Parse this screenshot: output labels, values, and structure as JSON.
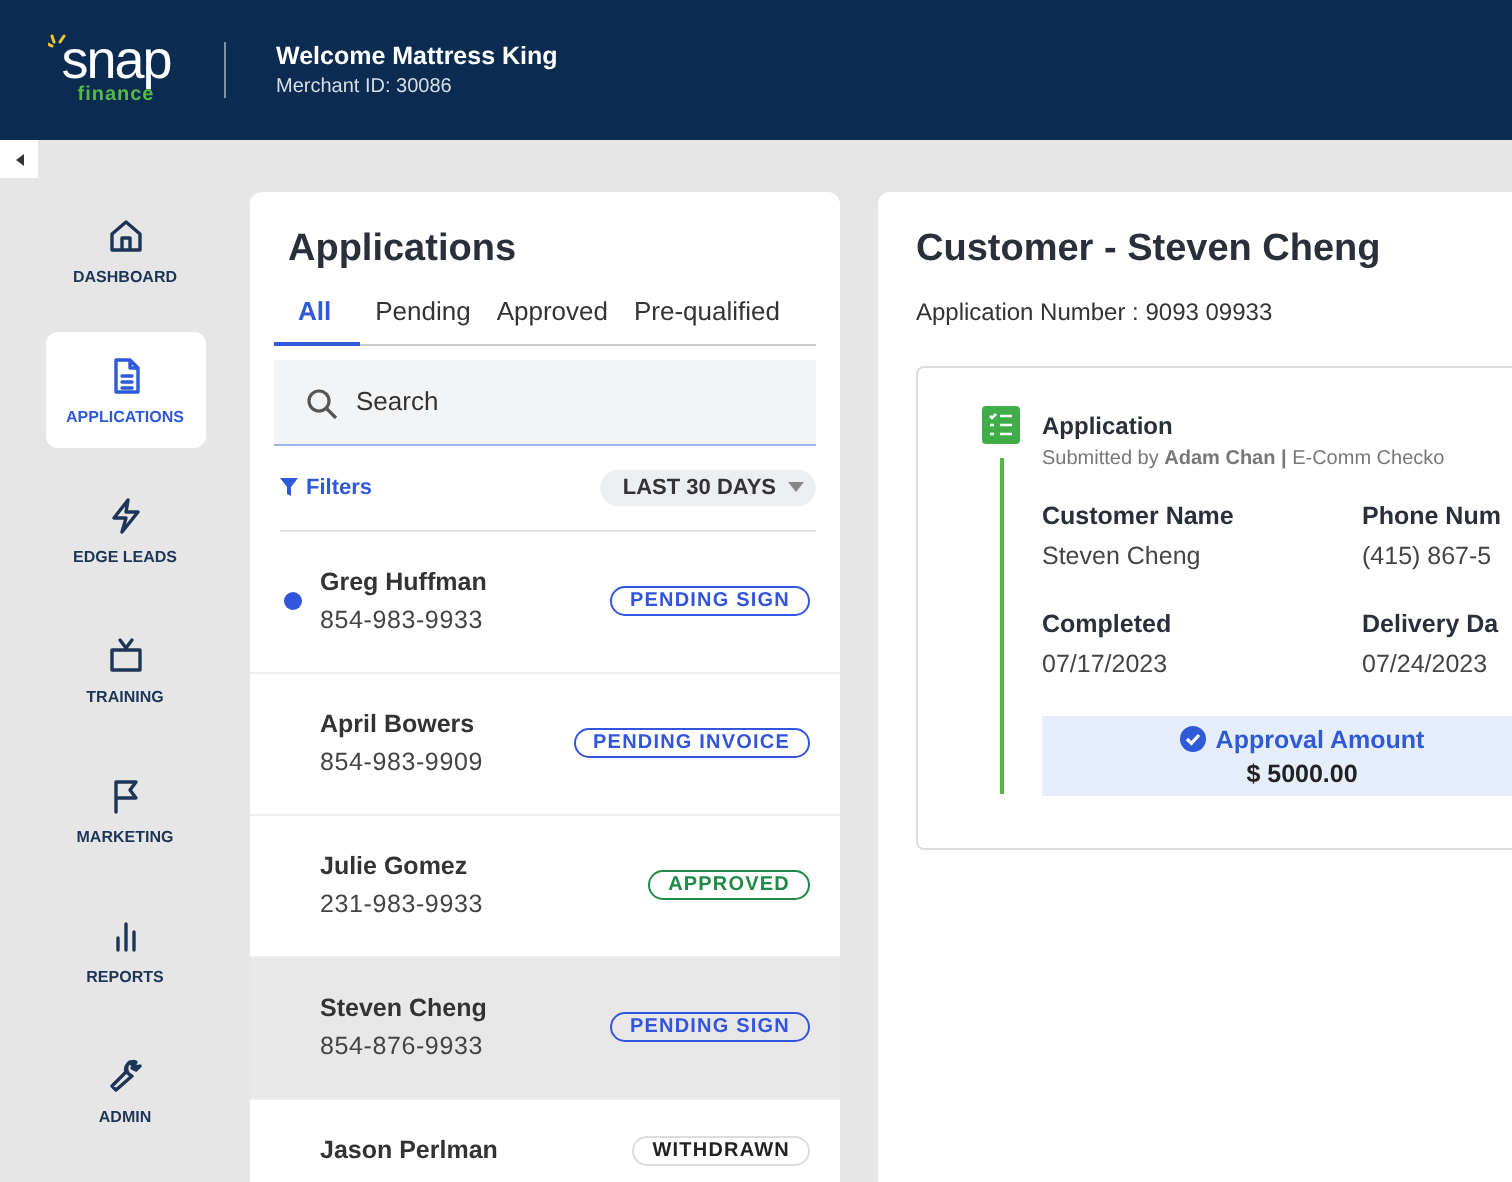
{
  "header": {
    "logo": {
      "word": "snap",
      "sub": "finance"
    },
    "welcome": "Welcome Mattress King",
    "merchant_id": "Merchant ID: 30086"
  },
  "sidebar": {
    "items": [
      {
        "kind": "home",
        "label": "DASHBOARD",
        "selected": false
      },
      {
        "kind": "document",
        "label": "APPLICATIONS",
        "selected": true
      },
      {
        "kind": "bolt",
        "label": "EDGE LEADS",
        "selected": false
      },
      {
        "kind": "tv",
        "label": "TRAINING",
        "selected": false
      },
      {
        "kind": "flag",
        "label": "MARKETING",
        "selected": false
      },
      {
        "kind": "bars",
        "label": "REPORTS",
        "selected": false
      },
      {
        "kind": "wrench",
        "label": "ADMIN",
        "selected": false
      }
    ]
  },
  "applications": {
    "title": "Applications",
    "tabs": [
      {
        "label": "All",
        "selected": true
      },
      {
        "label": "Pending",
        "selected": false
      },
      {
        "label": "Approved",
        "selected": false
      },
      {
        "label": "Pre-qualified",
        "selected": false
      }
    ],
    "search": {
      "placeholder": "Search"
    },
    "filters": "Filters",
    "date_range": "LAST 30 DAYS",
    "rows": [
      {
        "name": "Greg Huffman",
        "phone": "854-983-9933",
        "status": "PENDING SIGN",
        "kind": "pending",
        "unread": true,
        "selected": false
      },
      {
        "name": "April Bowers",
        "phone": "854-983-9909",
        "status": "PENDING INVOICE",
        "kind": "pending",
        "unread": false,
        "selected": false
      },
      {
        "name": "Julie Gomez",
        "phone": "231-983-9933",
        "status": "APPROVED",
        "kind": "approved",
        "unread": false,
        "selected": false
      },
      {
        "name": "Steven Cheng",
        "phone": "854-876-9933",
        "status": "PENDING SIGN",
        "kind": "pending",
        "unread": false,
        "selected": true
      },
      {
        "name": "Jason Perlman",
        "status": "WITHDRAWN",
        "kind": "withdrawn",
        "unread": false,
        "selected": false
      }
    ]
  },
  "detail": {
    "title": "Customer - Steven Cheng",
    "application_number": "Application Number : 9093 09933",
    "card": {
      "title": "Application",
      "submitted": "Submitted by **Adam Chan |** E-Comm Checko",
      "fields": [
        {
          "label": "Customer Name",
          "value": "Steven Cheng"
        },
        {
          "label": "Phone Num",
          "value": "(415) 867-5"
        },
        {
          "label": "Completed",
          "value": "07/17/2023"
        },
        {
          "label": "Delivery Da",
          "value": "07/24/2023"
        }
      ],
      "approval": {
        "label": "Approval Amount",
        "amount": "$ 5000.00"
      }
    }
  }
}
